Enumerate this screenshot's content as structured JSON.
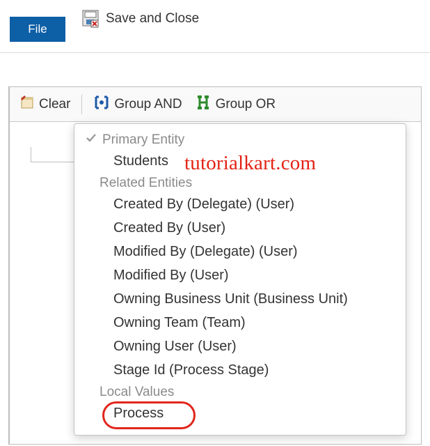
{
  "ribbon": {
    "file_tab": "File",
    "save_close_label": "Save and Close"
  },
  "toolbar": {
    "clear_label": "Clear",
    "group_and_label": "Group AND",
    "group_or_label": "Group OR"
  },
  "dropdown": {
    "section_primary": "Primary Entity",
    "primary_items": [
      "Students"
    ],
    "section_related": "Related Entities",
    "related_items": [
      "Created By (Delegate) (User)",
      "Created By (User)",
      "Modified By (Delegate) (User)",
      "Modified By (User)",
      "Owning Business Unit (Business Unit)",
      "Owning Team (Team)",
      "Owning User (User)",
      "Stage Id (Process Stage)"
    ],
    "section_local": "Local Values",
    "local_items": [
      "Process"
    ]
  },
  "watermark": "tutorialkart.com"
}
